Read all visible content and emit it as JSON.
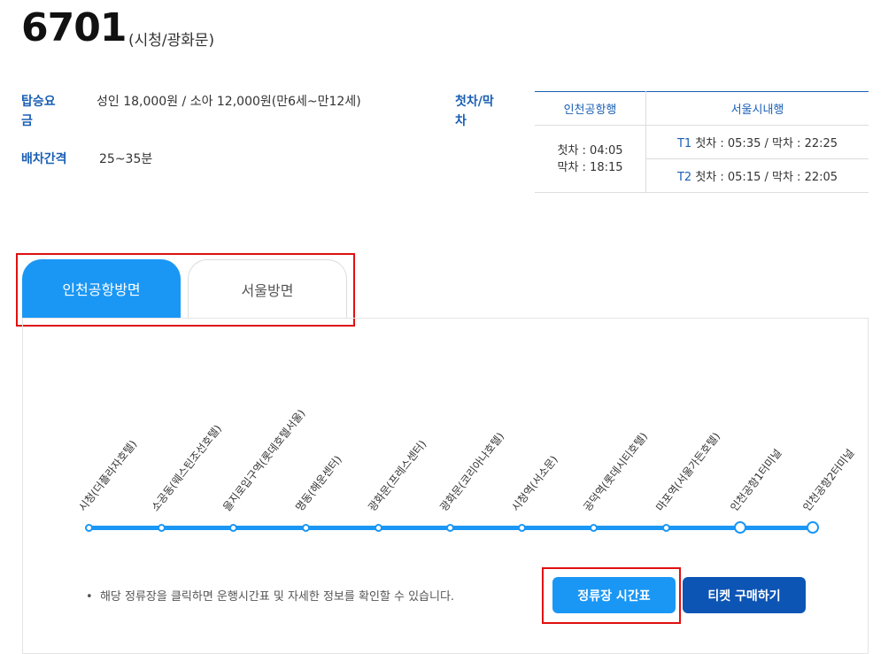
{
  "route": {
    "number": "6701",
    "subtitle": "(시청/광화문)"
  },
  "info": {
    "fare_label": "탑승요금",
    "fare_value": "성인 18,000원 / 소아 12,000원(만6세~만12세)",
    "interval_label": "배차간격",
    "interval_value": "25~35분",
    "firstlast_label": "첫차/막차"
  },
  "schedule": {
    "col1_header": "인천공항행",
    "col2_header": "서울시내행",
    "incheon_first": "첫차 : 04:05",
    "incheon_last": "막차 : 18:15",
    "t1_code": "T1",
    "t1_times": "첫차 : 05:35 / 막차 : 22:25",
    "t2_code": "T2",
    "t2_times": "첫차 : 05:15 / 막차 : 22:05"
  },
  "tabs": {
    "active": "인천공항방면",
    "inactive": "서울방면"
  },
  "stops": [
    "시청(더플라자호텔)",
    "소공동(웨스틴조선호텔)",
    "을지로입구역(롯데호텔서울)",
    "명동(해운센터)",
    "광화문(프레스센터)",
    "광화문(코리아나호텔)",
    "시청역(서소문)",
    "공덕역(롯데시티호텔)",
    "마포역(서울가든호텔)",
    "인천공항1터미널",
    "인천공항2터미널"
  ],
  "notice": "해당 정류장을 클릭하면 운행시간표 및 자세한 정보를 확인할 수 있습니다.",
  "buttons": {
    "timetable": "정류장 시간표",
    "ticket": "티켓 구매하기"
  },
  "colors": {
    "accent": "#1a97f5",
    "dark_button": "#0c55b5",
    "label_blue": "#1a5fb4",
    "highlight": "#e01010"
  }
}
